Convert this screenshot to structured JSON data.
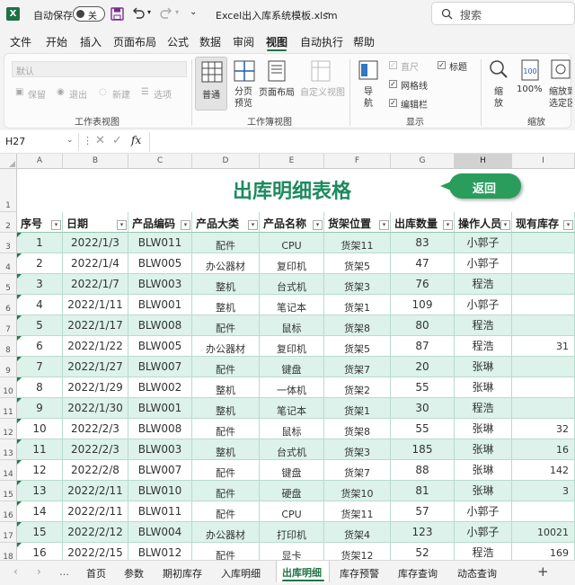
{
  "app": {
    "autosave_label": "自动保存",
    "autosave_state": "关",
    "filename": "Excel出入库系统模板.xlsm",
    "search_placeholder": "搜索",
    "undo_icon": "undo-icon",
    "redo_icon": "redo-icon"
  },
  "menu": [
    "文件",
    "开始",
    "插入",
    "页面布局",
    "公式",
    "数据",
    "审阅",
    "视图",
    "自动执行",
    "帮助"
  ],
  "menu_active": "视图",
  "ribbon": {
    "sheetview": {
      "dropdown": "默认",
      "keep": "保留",
      "exit": "退出",
      "new": "新建",
      "options": "选项",
      "label": "工作表视图"
    },
    "workbookview": {
      "normal": "普通",
      "pagebreak": [
        "分页",
        "预览"
      ],
      "pagelayout": "页面布局",
      "custom": "自定义视图",
      "label": "工作簿视图"
    },
    "show": {
      "nav": [
        "导",
        "航"
      ],
      "ruler": "直尺",
      "gridlines": "网格线",
      "formulabar": "编辑栏",
      "headings": "标题",
      "label": "显示"
    },
    "zoom": {
      "zoom": [
        "缩",
        "放"
      ],
      "hundred": "100%",
      "fit": [
        "缩放到",
        "选定区域"
      ],
      "label": "缩放"
    }
  },
  "formula_bar": {
    "name_box": "H27",
    "fx": "fx",
    "formula": ""
  },
  "sheet": {
    "columns": [
      "A",
      "B",
      "C",
      "D",
      "E",
      "F",
      "G",
      "H",
      "I"
    ],
    "selected_column": "H",
    "title": "出库明细表格",
    "return_button": "返回",
    "headers": [
      "序号",
      "日期",
      "产品编码",
      "产品大类",
      "产品名称",
      "货架位置",
      "出库数量",
      "操作人员",
      "现有库存"
    ],
    "row_numbers": [
      "1",
      "2",
      "3",
      "4",
      "5",
      "6",
      "7",
      "8",
      "9",
      "10",
      "11",
      "12",
      "13",
      "14",
      "15",
      "16",
      "17",
      "18"
    ],
    "rows": [
      [
        "1",
        "2022/1/3",
        "BLW011",
        "配件",
        "CPU",
        "货架11",
        "83",
        "小郭子",
        ""
      ],
      [
        "2",
        "2022/1/4",
        "BLW005",
        "办公器材",
        "复印机",
        "货架5",
        "47",
        "小郭子",
        ""
      ],
      [
        "3",
        "2022/1/7",
        "BLW003",
        "整机",
        "台式机",
        "货架3",
        "76",
        "程浩",
        ""
      ],
      [
        "4",
        "2022/1/11",
        "BLW001",
        "整机",
        "笔记本",
        "货架1",
        "109",
        "小郭子",
        ""
      ],
      [
        "5",
        "2022/1/17",
        "BLW008",
        "配件",
        "鼠标",
        "货架8",
        "80",
        "程浩",
        ""
      ],
      [
        "6",
        "2022/1/22",
        "BLW005",
        "办公器材",
        "复印机",
        "货架5",
        "87",
        "程浩",
        "31"
      ],
      [
        "7",
        "2022/1/27",
        "BLW007",
        "配件",
        "键盘",
        "货架7",
        "20",
        "张琳",
        ""
      ],
      [
        "8",
        "2022/1/29",
        "BLW002",
        "整机",
        "一体机",
        "货架2",
        "55",
        "张琳",
        ""
      ],
      [
        "9",
        "2022/1/30",
        "BLW001",
        "整机",
        "笔记本",
        "货架1",
        "30",
        "程浩",
        ""
      ],
      [
        "10",
        "2022/2/3",
        "BLW008",
        "配件",
        "鼠标",
        "货架8",
        "55",
        "张琳",
        "32"
      ],
      [
        "11",
        "2022/2/3",
        "BLW003",
        "整机",
        "台式机",
        "货架3",
        "185",
        "张琳",
        "16"
      ],
      [
        "12",
        "2022/2/8",
        "BLW007",
        "配件",
        "键盘",
        "货架7",
        "88",
        "张琳",
        "142"
      ],
      [
        "13",
        "2022/2/11",
        "BLW010",
        "配件",
        "硬盘",
        "货架10",
        "81",
        "张琳",
        "3"
      ],
      [
        "14",
        "2022/2/11",
        "BLW011",
        "配件",
        "CPU",
        "货架11",
        "57",
        "小郭子",
        ""
      ],
      [
        "15",
        "2022/2/12",
        "BLW004",
        "办公器材",
        "打印机",
        "货架4",
        "123",
        "小郭子",
        "10021"
      ],
      [
        "16",
        "2022/2/15",
        "BLW012",
        "配件",
        "显卡",
        "货架12",
        "52",
        "程浩",
        "169"
      ]
    ],
    "band_color": "#dcf2ea",
    "accent": "#1d8a5f",
    "title_color": "#1d8a5f"
  },
  "tabs": {
    "items": [
      "首页",
      "参数",
      "期初库存",
      "入库明细",
      "出库明细",
      "库存预警",
      "库存查询",
      "动态查询"
    ],
    "active": "出库明细",
    "add": "+"
  },
  "colors": {
    "excel_green": "#217346",
    "button_green": "#2a9d5c"
  }
}
